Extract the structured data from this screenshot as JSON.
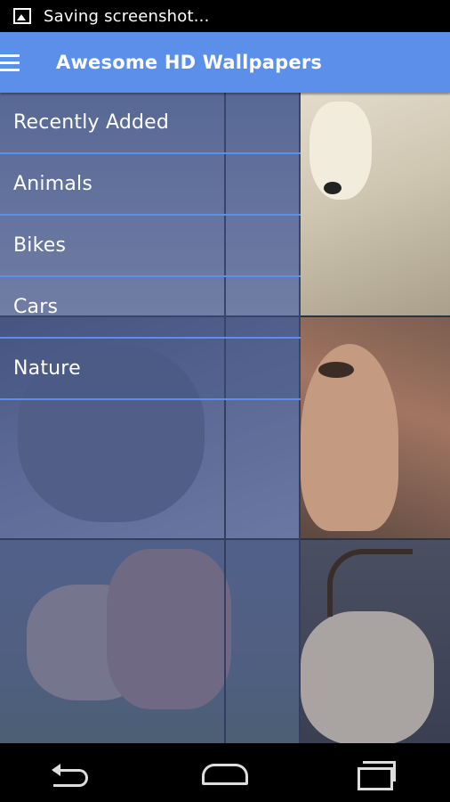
{
  "status_bar": {
    "notification_icon": "image-icon",
    "text": "Saving screenshot..."
  },
  "action_bar": {
    "menu_icon": "hamburger-menu-icon",
    "title": "Awesome HD Wallpapers",
    "color": "#5b8fe9"
  },
  "drawer": {
    "items": [
      {
        "label": "Recently Added"
      },
      {
        "label": "Animals"
      },
      {
        "label": "Bikes"
      },
      {
        "label": "Cars"
      },
      {
        "label": "Nature"
      }
    ]
  },
  "grid": {
    "thumbnails": [
      {
        "name": "wolf-thumbnail"
      },
      {
        "name": "polar-bear-thumbnail"
      },
      {
        "name": "lemur-thumbnail"
      },
      {
        "name": "meerkat-thumbnail"
      },
      {
        "name": "horses-thumbnail"
      },
      {
        "name": "reindeer-thumbnail"
      }
    ]
  },
  "nav_bar": {
    "back_icon": "back-icon",
    "home_icon": "home-icon",
    "recents_icon": "recents-icon"
  }
}
